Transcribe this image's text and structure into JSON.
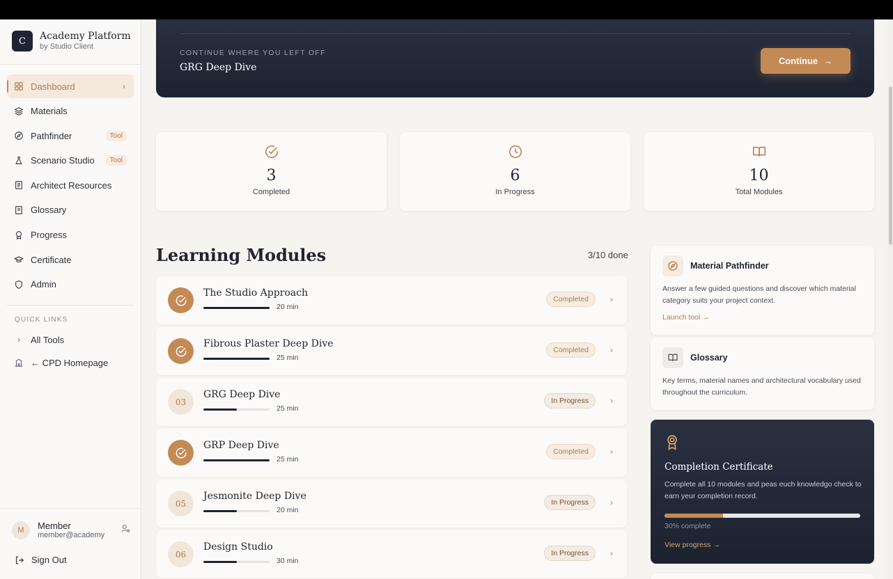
{
  "brand": {
    "logo_letter": "C",
    "title": "Academy Platform",
    "subtitle": "by Studio Client"
  },
  "sidebar": {
    "items": [
      {
        "label": "Dashboard",
        "icon": "grid-icon",
        "active": true
      },
      {
        "label": "Materials",
        "icon": "layers-icon"
      },
      {
        "label": "Pathfinder",
        "icon": "compass-icon",
        "badge": "Tool"
      },
      {
        "label": "Scenario Studio",
        "icon": "flask-icon",
        "badge": "Tool"
      },
      {
        "label": "Architect Resources",
        "icon": "document-icon"
      },
      {
        "label": "Glossary",
        "icon": "notebook-icon"
      },
      {
        "label": "Progress",
        "icon": "award-icon"
      },
      {
        "label": "Certificate",
        "icon": "graduation-cap-icon"
      },
      {
        "label": "Admin",
        "icon": "shield-icon"
      }
    ],
    "quick_links_title": "QUICK LINKS",
    "quick_links": [
      {
        "label": "All Tools",
        "icon": "chevron-right-icon"
      },
      {
        "label": "← CPD Homepage",
        "icon": "building-icon"
      }
    ],
    "user": {
      "initial": "M",
      "name": "Member",
      "email": "member@academy"
    },
    "sign_out": "Sign Out"
  },
  "hero": {
    "kicker": "CONTINUE WHERE YOU LEFT OFF",
    "title": "GRG Deep Dive",
    "button": "Continue"
  },
  "stats": [
    {
      "value": "3",
      "label": "Completed",
      "icon": "check-circle-icon"
    },
    {
      "value": "6",
      "label": "In Progress",
      "icon": "clock-icon"
    },
    {
      "value": "10",
      "label": "Total Modules",
      "icon": "book-open-icon"
    }
  ],
  "modules_section": {
    "title": "Learning Modules",
    "count": "3/10 done"
  },
  "modules": [
    {
      "num": "",
      "title": "The Studio Approach",
      "duration": "20 min",
      "status": "Completed",
      "done": true,
      "progress": 1.0
    },
    {
      "num": "",
      "title": "Fibrous Plaster Deep Dive",
      "duration": "25 min",
      "status": "Completed",
      "done": true,
      "progress": 1.0
    },
    {
      "num": "03",
      "title": "GRG Deep Dive",
      "duration": "25 min",
      "status": "In Progress",
      "done": false,
      "progress": 0.5
    },
    {
      "num": "",
      "title": "GRP Deep Dive",
      "duration": "25 min",
      "status": "Completed",
      "done": true,
      "progress": 1.0
    },
    {
      "num": "05",
      "title": "Jesmonite Deep Dive",
      "duration": "20 min",
      "status": "In Progress",
      "done": false,
      "progress": 0.5
    },
    {
      "num": "06",
      "title": "Design Studio",
      "duration": "30 min",
      "status": "In Progress",
      "done": false,
      "progress": 0.5
    }
  ],
  "tools": {
    "pathfinder": {
      "title": "Material Pathfinder",
      "desc": "Answer a few guided questions and discover which material category suits your project context.",
      "link": "Launch tool →"
    },
    "glossary": {
      "title": "Glossary",
      "desc": "Key terms, material names and architectural vocabulary used throughout the curriculum."
    }
  },
  "certificate": {
    "title": "Completion Certificate",
    "desc": "Complete all 10 modules and peas euch knowledgo check to earn yeur completion record.",
    "percent_label": "30% complete",
    "progress": 0.3,
    "link": "View progress →"
  },
  "colors": {
    "accent": "#c48a55",
    "dark": "#1f2433",
    "background": "#f6f4f0"
  }
}
